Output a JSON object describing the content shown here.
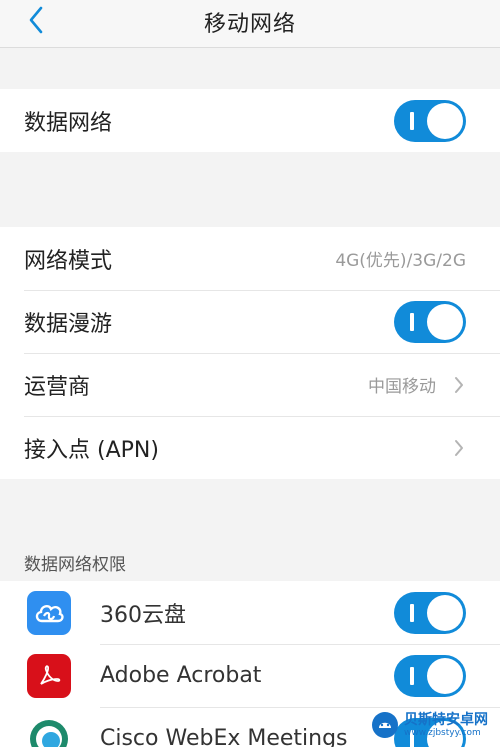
{
  "header": {
    "title": "移动网络",
    "back_icon": "chevron-left-icon"
  },
  "data_network": {
    "label": "数据网络",
    "enabled": true
  },
  "settings": {
    "network_mode": {
      "label": "网络模式",
      "value": "4G(优先)/3G/2G"
    },
    "data_roaming": {
      "label": "数据漫游",
      "enabled": true
    },
    "carrier": {
      "label": "运营商",
      "value": "中国移动"
    },
    "apn": {
      "label": "接入点 (APN)"
    }
  },
  "permissions": {
    "header": "数据网络权限",
    "apps": [
      {
        "name": "360云盘",
        "icon": "cloud-drive-icon",
        "color": "#2f8ff0",
        "enabled": true
      },
      {
        "name": "Adobe Acrobat",
        "icon": "acrobat-icon",
        "color": "#d8101a",
        "enabled": true
      },
      {
        "name": "Cisco WebEx Meetings",
        "icon": "webex-icon",
        "color": "#1d8a6b",
        "enabled": true
      }
    ]
  },
  "colors": {
    "accent": "#118bd9",
    "background": "#f3f3f3"
  },
  "watermark": {
    "title": "贝斯特安卓网",
    "url": "www.zjbstyy.com"
  }
}
